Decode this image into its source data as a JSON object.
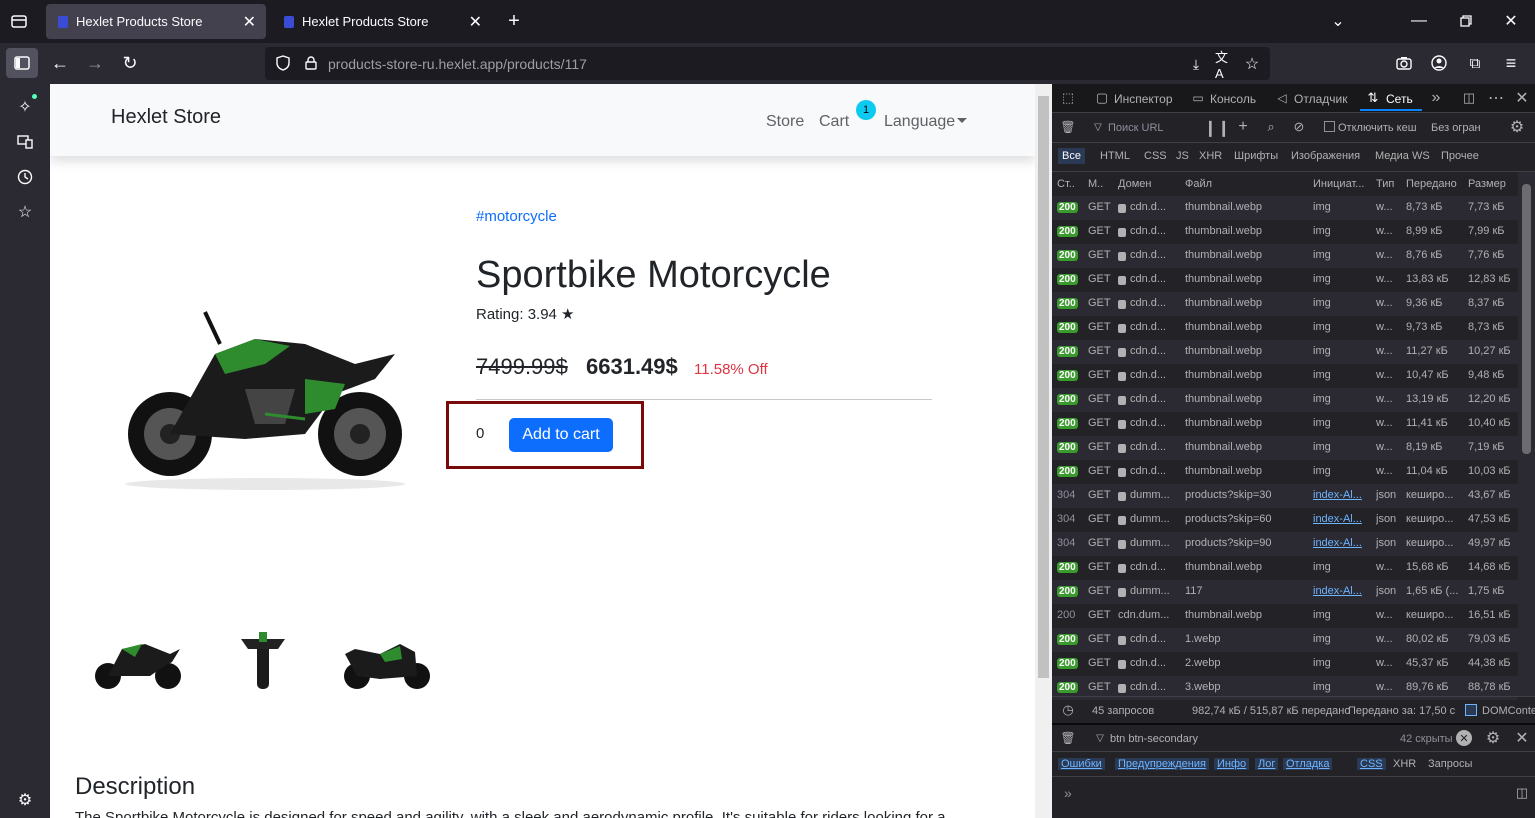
{
  "browser": {
    "tabs": [
      {
        "title": "Hexlet Products Store",
        "active": true
      },
      {
        "title": "Hexlet Products Store",
        "active": false
      }
    ],
    "url": {
      "host": "products-store-ru.hexlet.app",
      "path": "/products/117"
    }
  },
  "page": {
    "brand": "Hexlet Store",
    "nav": {
      "store": "Store",
      "cart": "Cart",
      "cart_count": "1",
      "language": "Language"
    },
    "product": {
      "tag": "#motorcycle",
      "title": "Sportbike Motorcycle",
      "rating": "Rating: 3.94 ★",
      "old_price": "7499.99$",
      "new_price": "6631.49$",
      "discount": "11.58% Off",
      "quantity": "0",
      "add_to_cart": "Add to cart"
    },
    "description": {
      "heading": "Description",
      "text": "The Sportbike Motorcycle is designed for speed and agility, with a sleek and aerodynamic profile. It's suitable for riders looking for a"
    }
  },
  "devtools": {
    "tabs": {
      "inspector": "Инспектор",
      "console": "Консоль",
      "debugger": "Отладчик",
      "network": "Сеть"
    },
    "filter_placeholder": "Поиск URL",
    "disable_cache": "Отключить кеш",
    "throttle": "Без огран",
    "type_filters": [
      "Все",
      "HTML",
      "CSS",
      "JS",
      "XHR",
      "Шрифты",
      "Изображения",
      "Медиа",
      "WS",
      "Прочее"
    ],
    "columns": [
      "Ст..",
      "М..",
      "Домен",
      "Файл",
      "Инициат...",
      "Тип",
      "Передано",
      "Размер"
    ],
    "rows": [
      {
        "status": "200",
        "method": "GET",
        "domain": "cdn.d...",
        "file": "thumbnail.webp",
        "initiator": "img",
        "type": "w...",
        "transferred": "8,73 кБ",
        "size": "7,73 кБ"
      },
      {
        "status": "200",
        "method": "GET",
        "domain": "cdn.d...",
        "file": "thumbnail.webp",
        "initiator": "img",
        "type": "w...",
        "transferred": "8,99 кБ",
        "size": "7,99 кБ"
      },
      {
        "status": "200",
        "method": "GET",
        "domain": "cdn.d...",
        "file": "thumbnail.webp",
        "initiator": "img",
        "type": "w...",
        "transferred": "8,76 кБ",
        "size": "7,76 кБ"
      },
      {
        "status": "200",
        "method": "GET",
        "domain": "cdn.d...",
        "file": "thumbnail.webp",
        "initiator": "img",
        "type": "w...",
        "transferred": "13,83 кБ",
        "size": "12,83 кБ"
      },
      {
        "status": "200",
        "method": "GET",
        "domain": "cdn.d...",
        "file": "thumbnail.webp",
        "initiator": "img",
        "type": "w...",
        "transferred": "9,36 кБ",
        "size": "8,37 кБ"
      },
      {
        "status": "200",
        "method": "GET",
        "domain": "cdn.d...",
        "file": "thumbnail.webp",
        "initiator": "img",
        "type": "w...",
        "transferred": "9,73 кБ",
        "size": "8,73 кБ"
      },
      {
        "status": "200",
        "method": "GET",
        "domain": "cdn.d...",
        "file": "thumbnail.webp",
        "initiator": "img",
        "type": "w...",
        "transferred": "11,27 кБ",
        "size": "10,27 кБ"
      },
      {
        "status": "200",
        "method": "GET",
        "domain": "cdn.d...",
        "file": "thumbnail.webp",
        "initiator": "img",
        "type": "w...",
        "transferred": "10,47 кБ",
        "size": "9,48 кБ"
      },
      {
        "status": "200",
        "method": "GET",
        "domain": "cdn.d...",
        "file": "thumbnail.webp",
        "initiator": "img",
        "type": "w...",
        "transferred": "13,19 кБ",
        "size": "12,20 кБ"
      },
      {
        "status": "200",
        "method": "GET",
        "domain": "cdn.d...",
        "file": "thumbnail.webp",
        "initiator": "img",
        "type": "w...",
        "transferred": "11,41 кБ",
        "size": "10,40 кБ"
      },
      {
        "status": "200",
        "method": "GET",
        "domain": "cdn.d...",
        "file": "thumbnail.webp",
        "initiator": "img",
        "type": "w...",
        "transferred": "8,19 кБ",
        "size": "7,19 кБ"
      },
      {
        "status": "200",
        "method": "GET",
        "domain": "cdn.d...",
        "file": "thumbnail.webp",
        "initiator": "img",
        "type": "w...",
        "transferred": "11,04 кБ",
        "size": "10,03 кБ"
      },
      {
        "status": "304",
        "method": "GET",
        "domain": "dumm...",
        "file": "products?skip=30",
        "initiator": "index-Al...",
        "type": "json",
        "transferred": "кеширо...",
        "size": "43,67 кБ"
      },
      {
        "status": "304",
        "method": "GET",
        "domain": "dumm...",
        "file": "products?skip=60",
        "initiator": "index-Al...",
        "type": "json",
        "transferred": "кеширо...",
        "size": "47,53 кБ"
      },
      {
        "status": "304",
        "method": "GET",
        "domain": "dumm...",
        "file": "products?skip=90",
        "initiator": "index-Al...",
        "type": "json",
        "transferred": "кеширо...",
        "size": "49,97 кБ"
      },
      {
        "status": "200",
        "method": "GET",
        "domain": "cdn.d...",
        "file": "thumbnail.webp",
        "initiator": "img",
        "type": "w...",
        "transferred": "15,68 кБ",
        "size": "14,68 кБ"
      },
      {
        "status": "200",
        "method": "GET",
        "domain": "dumm...",
        "file": "117",
        "initiator": "index-Al...",
        "type": "json",
        "transferred": "1,65 кБ (...",
        "size": "1,75 кБ"
      },
      {
        "status": "200",
        "method": "GET",
        "domain": "cdn.dum...",
        "file": "thumbnail.webp",
        "initiator": "img",
        "type": "w...",
        "transferred": "кеширо...",
        "size": "16,51 кБ"
      },
      {
        "status": "200",
        "method": "GET",
        "domain": "cdn.d...",
        "file": "1.webp",
        "initiator": "img",
        "type": "w...",
        "transferred": "80,02 кБ",
        "size": "79,03 кБ"
      },
      {
        "status": "200",
        "method": "GET",
        "domain": "cdn.d...",
        "file": "2.webp",
        "initiator": "img",
        "type": "w...",
        "transferred": "45,37 кБ",
        "size": "44,38 кБ"
      },
      {
        "status": "200",
        "method": "GET",
        "domain": "cdn.d...",
        "file": "3.webp",
        "initiator": "img",
        "type": "w...",
        "transferred": "89,76 кБ",
        "size": "88,78 кБ"
      }
    ],
    "summary": {
      "requests": "45 запросов",
      "transferred": "982,74 кБ / 515,87 кБ передано",
      "finish": "Передано за: 17,50 с",
      "domcontent": "DOMConte"
    },
    "console_filter": "btn btn-secondary",
    "hidden_count": "42 скрыты",
    "console_tabs": [
      "Ошибки",
      "Предупреждения",
      "Инфо",
      "Лог",
      "Отладка",
      "CSS",
      "XHR",
      "Запросы"
    ]
  }
}
